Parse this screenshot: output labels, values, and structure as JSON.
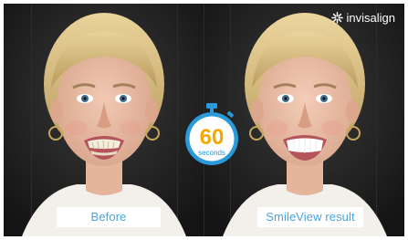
{
  "brand": {
    "name": "invisalign",
    "icon": "starburst-logo-icon"
  },
  "timer": {
    "value": "60",
    "unit": "seconds",
    "ring_color": "#2b9ad8",
    "number_color": "#f5a800"
  },
  "panels": {
    "before": {
      "label": "Before",
      "image": "woman-smiling-before-photo"
    },
    "after": {
      "label": "SmileView result",
      "image": "woman-smiling-after-photo"
    }
  },
  "colors": {
    "label_text": "#4aa3df",
    "background": "#1c1c1c"
  }
}
